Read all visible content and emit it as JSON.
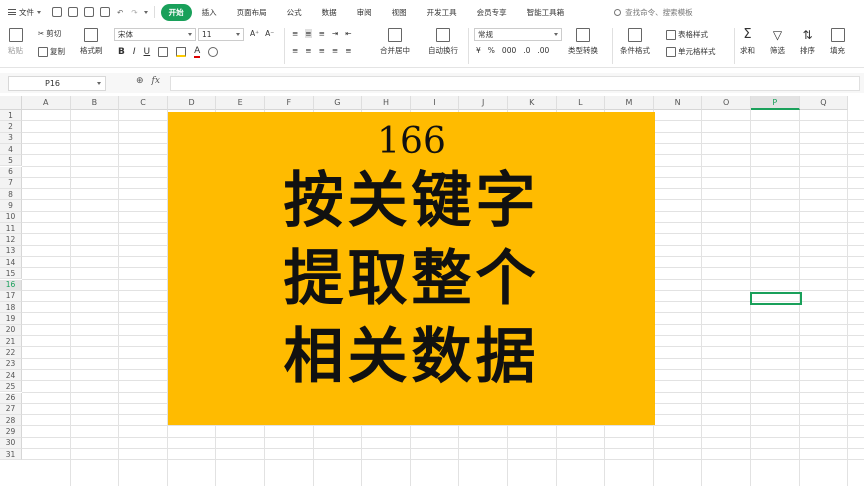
{
  "menubar": {
    "file_label": "文件",
    "tabs": [
      "开始",
      "插入",
      "页面布局",
      "公式",
      "数据",
      "审阅",
      "视图",
      "开发工具",
      "会员专享",
      "智能工具箱"
    ],
    "search_placeholder": "查找命令、搜索模板"
  },
  "ribbon": {
    "paste": "粘贴",
    "cut": "剪切",
    "copy": "复制",
    "format_painter": "格式刷",
    "font_name": "宋体",
    "font_size": "11",
    "bold": "B",
    "italic": "I",
    "underline": "U",
    "merge_center": "合并居中",
    "wrap_text": "自动换行",
    "number_format": "常规",
    "currency": "¥",
    "percent": "%",
    "thousands": "000",
    "type_convert": "类型转换",
    "conditional_format": "条件格式",
    "table_style": "表格样式",
    "cell_style": "单元格样式",
    "sum": "求和",
    "filter": "筛选",
    "sort": "排序",
    "fill": "填充"
  },
  "formula_bar": {
    "cell_ref": "P16",
    "fx": "fx",
    "value": ""
  },
  "grid": {
    "columns": [
      "A",
      "B",
      "C",
      "D",
      "E",
      "F",
      "G",
      "H",
      "I",
      "J",
      "K",
      "L",
      "M",
      "N",
      "O",
      "P",
      "Q"
    ],
    "rows": [
      "1",
      "2",
      "3",
      "4",
      "5",
      "6",
      "7",
      "8",
      "9",
      "10",
      "11",
      "12",
      "13",
      "14",
      "15",
      "16",
      "17",
      "18",
      "19",
      "20",
      "21",
      "22",
      "23",
      "24",
      "25",
      "26",
      "27",
      "28",
      "29",
      "30",
      "31"
    ],
    "selected_column": "P",
    "selected_row": "16"
  },
  "banner": {
    "number": "166",
    "lines": [
      "按关键字",
      "提取整个",
      "相关数据"
    ],
    "background": "#ffbb00"
  },
  "colors": {
    "accent": "#19a05a"
  }
}
